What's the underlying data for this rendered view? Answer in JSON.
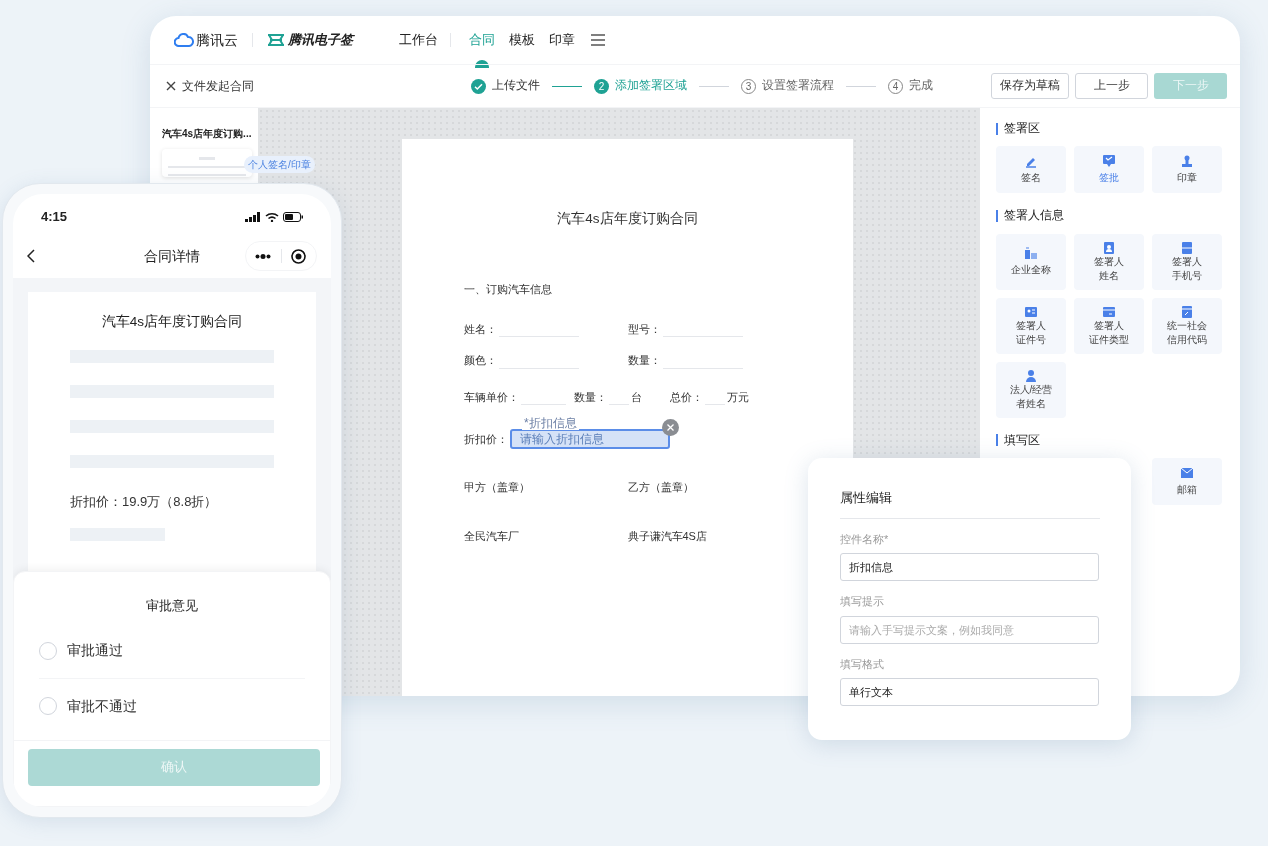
{
  "desktop_app": {
    "brand": {
      "cloud_logo": "腾讯云",
      "esign_logo": "腾讯电子签"
    },
    "nav": [
      {
        "label": "工作台",
        "selected": false
      },
      {
        "label": "合同",
        "selected": true
      },
      {
        "label": "模板",
        "selected": false
      },
      {
        "label": "印章",
        "selected": false
      }
    ],
    "close_label": "文件发起合同",
    "steps": [
      {
        "label": "上传文件",
        "completed": true,
        "selected": false
      },
      {
        "number": "2",
        "label": "添加签署区域",
        "completed": false,
        "selected": true
      },
      {
        "number": "3",
        "label": "设置签署流程",
        "completed": false,
        "selected": false
      },
      {
        "number": "4",
        "label": "完成",
        "completed": false,
        "selected": false
      }
    ],
    "buttons": [
      {
        "label": "保存为草稿",
        "kind": "default",
        "disabled": false
      },
      {
        "label": "上一步",
        "kind": "default",
        "disabled": false
      },
      {
        "label": "下一步",
        "kind": "primary",
        "disabled": true
      }
    ],
    "file_list": {
      "file_name": "汽车4s店年度订购...",
      "tag": "个人签名/印章"
    },
    "document": {
      "title": "汽车4s店年度订购合同",
      "section": "一、订购汽车信息",
      "info_rows": [
        [
          "姓名：",
          "型号："
        ],
        [
          "颜色：",
          "数量："
        ]
      ],
      "price_row": [
        {
          "text": "车辆单价：",
          "blank": true
        },
        {
          "text": "数量：",
          "blank": true
        },
        {
          "text": "台",
          "blank": false
        },
        {
          "text": "总价：",
          "blank": true
        },
        {
          "text": "万元",
          "blank": false
        }
      ],
      "discount": {
        "label": "折扣价：",
        "widget_label": "*折扣信息",
        "placeholder": "请输入折扣信息",
        "selected": true
      },
      "parties": [
        {
          "role": "甲方（盖章）",
          "name": "全民汽车厂"
        },
        {
          "role": "乙方（盖章）",
          "name": "典子谦汽车4S店"
        }
      ]
    },
    "control_panel": [
      {
        "title": "签署区",
        "items": [
          {
            "label": "签名",
            "selected": false
          },
          {
            "label": "签批",
            "selected": true
          },
          {
            "label": "印章",
            "selected": false
          }
        ]
      },
      {
        "title": "签署人信息",
        "items": [
          {
            "label": "企业全称",
            "selected": false
          },
          {
            "lines": [
              "签署人",
              "姓名"
            ],
            "selected": false
          },
          {
            "lines": [
              "签署人",
              "手机号"
            ],
            "selected": false
          },
          {
            "lines": [
              "签署人",
              "证件号"
            ],
            "selected": false
          },
          {
            "lines": [
              "签署人",
              "证件类型"
            ],
            "selected": false
          },
          {
            "lines": [
              "统一社会",
              "信用代码"
            ],
            "selected": false
          },
          {
            "lines": [
              "法人/经营",
              "者姓名"
            ],
            "selected": false
          }
        ]
      },
      {
        "title": "填写区",
        "items": [
          {
            "label": "邮箱",
            "selected": false
          }
        ]
      }
    ]
  },
  "phone": {
    "time": "4:15",
    "title": "合同详情",
    "doc_title": "汽车4s店年度订购合同",
    "discount_text": "折扣价：19.9万（8.8折）",
    "sheet": {
      "title": "审批意见",
      "options": [
        {
          "label": "审批通过",
          "selected": false
        },
        {
          "label": "审批不通过",
          "selected": false
        }
      ],
      "confirm": {
        "label": "确认",
        "disabled": true
      }
    }
  },
  "property_panel": {
    "title": "属性编辑",
    "fields": [
      {
        "label": "控件名称*",
        "value": "折扣信息"
      },
      {
        "label": "填写提示",
        "placeholder": "请输入手写提示文案，例如我同意"
      },
      {
        "label": "填写格式",
        "value": "单行文本"
      }
    ]
  }
}
